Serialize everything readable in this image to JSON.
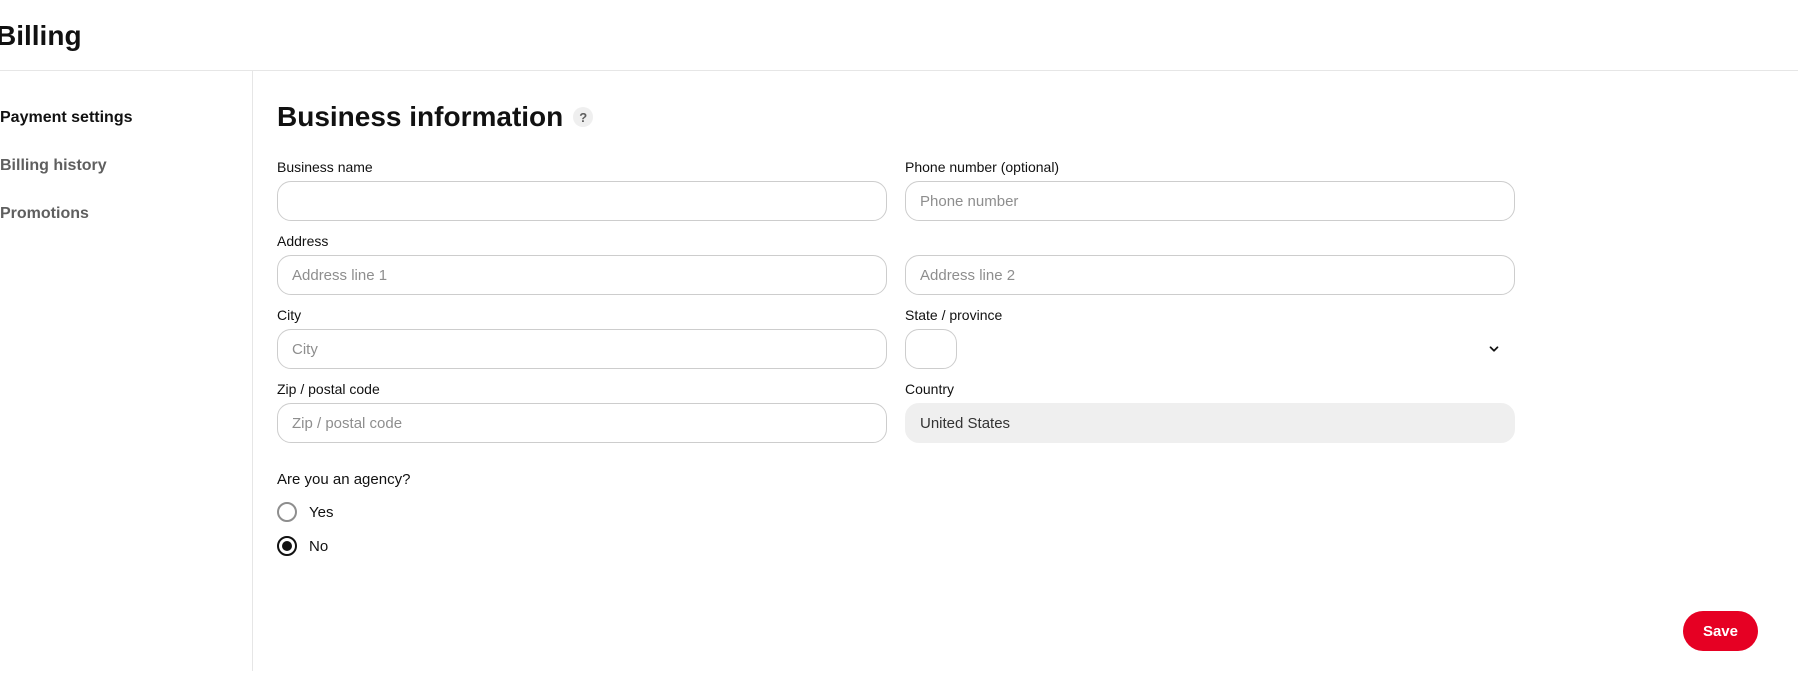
{
  "header": {
    "title": "Billing"
  },
  "sidebar": {
    "items": [
      {
        "label": "Payment settings",
        "active": true
      },
      {
        "label": "Billing history",
        "active": false
      },
      {
        "label": "Promotions",
        "active": false
      }
    ]
  },
  "section": {
    "title": "Business information",
    "help_glyph": "?"
  },
  "form": {
    "business_name": {
      "label": "Business name",
      "value": "",
      "placeholder": ""
    },
    "phone": {
      "label": "Phone number (optional)",
      "value": "",
      "placeholder": "Phone number"
    },
    "address": {
      "label": "Address",
      "value": "",
      "placeholder": "Address line 1"
    },
    "address2": {
      "label": "",
      "value": "",
      "placeholder": "Address line 2"
    },
    "city": {
      "label": "City",
      "value": "",
      "placeholder": "City"
    },
    "state": {
      "label": "State / province",
      "value": ""
    },
    "zip": {
      "label": "Zip / postal code",
      "value": "",
      "placeholder": "Zip / postal code"
    },
    "country": {
      "label": "Country",
      "value": "United States"
    }
  },
  "agency": {
    "question": "Are you an agency?",
    "options": {
      "yes": "Yes",
      "no": "No"
    },
    "selected": "no"
  },
  "actions": {
    "save": "Save"
  }
}
